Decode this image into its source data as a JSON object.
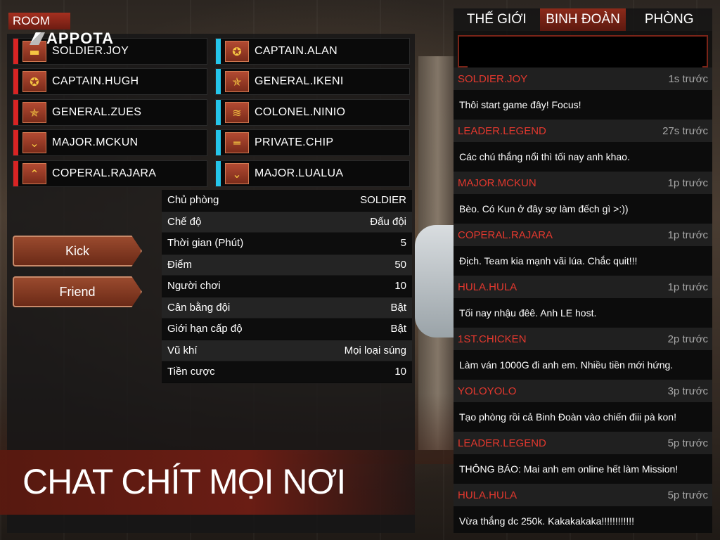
{
  "room": {
    "label": "ROOM"
  },
  "logo": {
    "text": "APPOTA"
  },
  "players": [
    {
      "name": "SOLDIER.JOY",
      "team": "red",
      "rank_icon": "minus"
    },
    {
      "name": "CAPTAIN.ALAN",
      "team": "cyan",
      "rank_icon": "star-circle"
    },
    {
      "name": "CAPTAIN.HUGH",
      "team": "red",
      "rank_icon": "star-circle"
    },
    {
      "name": "GENERAL.IKENI",
      "team": "cyan",
      "rank_icon": "star-wreath"
    },
    {
      "name": "GENERAL.ZUES",
      "team": "red",
      "rank_icon": "star-wreath"
    },
    {
      "name": "COLONEL.NINIO",
      "team": "cyan",
      "rank_icon": "triple-chevron"
    },
    {
      "name": "MAJOR.MCKUN",
      "team": "red",
      "rank_icon": "chevron-wings"
    },
    {
      "name": "PRIVATE.CHIP",
      "team": "cyan",
      "rank_icon": "double-bar"
    },
    {
      "name": "COPERAL.RAJARA",
      "team": "red",
      "rank_icon": "chevron-up"
    },
    {
      "name": "MAJOR.LUALUA",
      "team": "cyan",
      "rank_icon": "chevron-wings"
    }
  ],
  "buttons": {
    "kick": "Kick",
    "friend": "Friend"
  },
  "info": [
    {
      "label": "Chủ phòng",
      "value": "SOLDIER"
    },
    {
      "label": "Chế độ",
      "value": "Đấu đội"
    },
    {
      "label": "Thời gian (Phút)",
      "value": "5"
    },
    {
      "label": "Điểm",
      "value": "50"
    },
    {
      "label": "Người chơi",
      "value": "10"
    },
    {
      "label": "Cân bằng đội",
      "value": "Bật"
    },
    {
      "label": "Giới hạn cấp độ",
      "value": "Bật"
    },
    {
      "label": "Vũ khí",
      "value": "Mọi loại súng"
    },
    {
      "label": "Tiền cược",
      "value": "10"
    }
  ],
  "banner": {
    "text": "CHAT CHÍT MỌI NƠI"
  },
  "tabs": [
    {
      "label": "THẾ GIỚI",
      "active": false
    },
    {
      "label": "BINH ĐOÀN",
      "active": true
    },
    {
      "label": "PHÒNG",
      "active": false
    }
  ],
  "chat": {
    "input_value": "",
    "messages": [
      {
        "user": "SOLDIER.JOY",
        "time": "1s trước",
        "text": "Thôi start game đây! Focus!"
      },
      {
        "user": "LEADER.LEGEND",
        "time": "27s trước",
        "text": "Các chú thắng nổi thì tối nay anh khao."
      },
      {
        "user": "MAJOR.MCKUN",
        "time": "1p trước",
        "text": "Bèo. Có Kun ở đây sợ làm đếch gì >:))"
      },
      {
        "user": "COPERAL.RAJARA",
        "time": "1p trước",
        "text": "Địch. Team kia mạnh vãi lúa. Chắc quit!!!"
      },
      {
        "user": "HULA.HULA",
        "time": "1p trước",
        "text": "Tối nay nhậu đêê. Anh LE host."
      },
      {
        "user": "1ST.CHICKEN",
        "time": "2p trước",
        "text": "Làm ván 1000G đi anh em. Nhiều tiền mới hứng."
      },
      {
        "user": "YOLOYOLO",
        "time": "3p trước",
        "text": "Tạo phòng rồi cả Binh Đoàn vào chiến điii pà kon!"
      },
      {
        "user": "LEADER.LEGEND",
        "time": "5p trước",
        "text": "THÔNG BÁO: Mai anh em online hết làm Mission!"
      },
      {
        "user": "HULA.HULA",
        "time": "5p trước",
        "text": "Vừa thắng dc 250k. Kakakakaka!!!!!!!!!!!!"
      }
    ]
  },
  "colors": {
    "team_red": "#d92424",
    "team_cyan": "#25c5ea",
    "accent": "#8c2a1a",
    "username": "#e2382e"
  }
}
